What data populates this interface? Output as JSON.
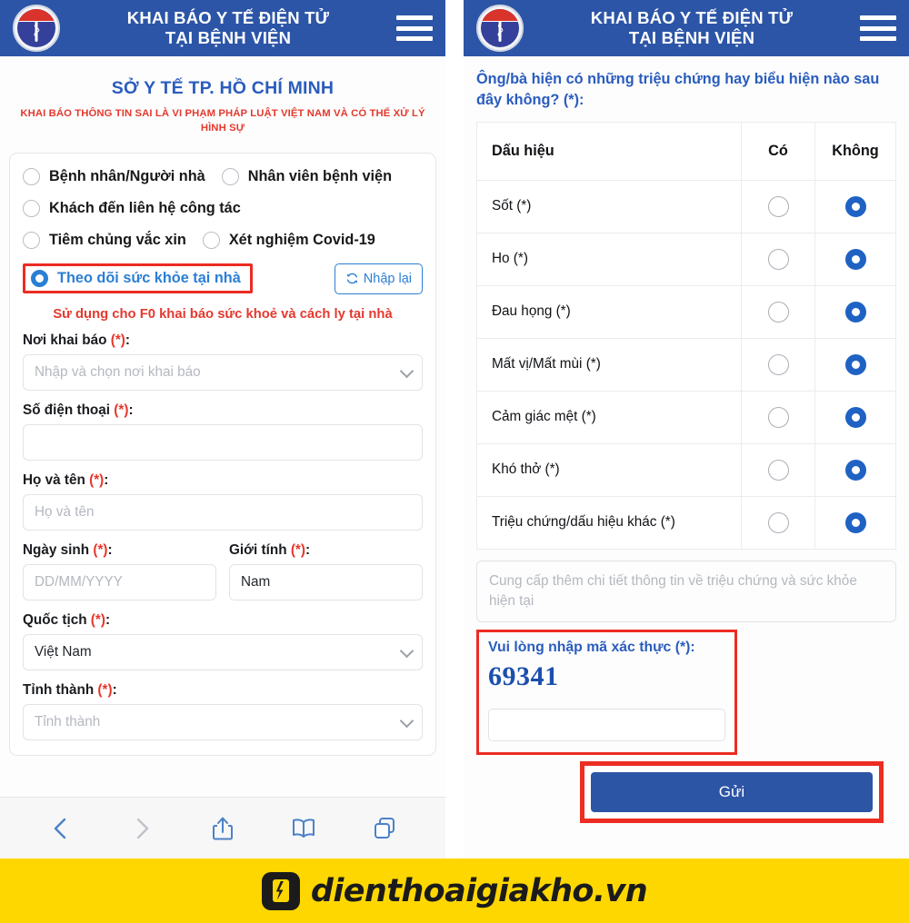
{
  "header": {
    "title_line1": "KHAI BÁO Y TẾ ĐIỆN TỬ",
    "title_line2": "TẠI BỆNH VIỆN",
    "logo_name": "ministry-of-health-emblem",
    "menu_icon": "hamburger-menu-icon",
    "bg_color": "#2c55a7"
  },
  "left": {
    "org_title": "SỞ Y TẾ TP. HỒ CHÍ MINH",
    "warning": "KHAI BÁO THÔNG TIN SAI LÀ VI PHẠM PHÁP LUẬT VIỆT NAM VÀ CÓ THỂ XỬ LÝ HÌNH SỰ",
    "radio_options": [
      {
        "label": "Bệnh nhân/Người nhà",
        "selected": false
      },
      {
        "label": "Nhân viên bệnh viện",
        "selected": false
      },
      {
        "label": "Khách đến liên hệ công tác",
        "selected": false
      },
      {
        "label": "Tiêm chủng vắc xin",
        "selected": false
      },
      {
        "label": "Xét nghiệm Covid-19",
        "selected": false
      },
      {
        "label": "Theo dõi sức khỏe tại nhà",
        "selected": true
      }
    ],
    "reset_button": "Nhập lại",
    "reset_icon": "refresh-icon",
    "note": "Sử dụng cho F0 khai báo sức khoẻ và cách ly tại nhà",
    "fields": [
      {
        "label": "Nơi khai báo",
        "required": "(*)",
        "placeholder": "Nhập và chọn nơi khai báo",
        "value": "",
        "type": "select"
      },
      {
        "label": "Số điện thoại",
        "required": "(*)",
        "placeholder": "",
        "value": "",
        "type": "text"
      },
      {
        "label": "Họ và tên",
        "required": "(*)",
        "placeholder": "Họ và tên",
        "value": "",
        "type": "text"
      },
      {
        "label": "Ngày sinh",
        "required": "(*)",
        "placeholder": "DD/MM/YYYY",
        "value": "",
        "type": "text"
      },
      {
        "label": "Giới tính",
        "required": "(*)",
        "placeholder": "",
        "value": "Nam",
        "type": "text"
      },
      {
        "label": "Quốc tịch",
        "required": "(*)",
        "placeholder": "",
        "value": "Việt Nam",
        "type": "select"
      },
      {
        "label": "Tỉnh thành",
        "required": "(*)",
        "placeholder": "Tỉnh thành",
        "value": "",
        "type": "select"
      }
    ],
    "toolbar": [
      {
        "name": "back-icon",
        "enabled": true
      },
      {
        "name": "forward-icon",
        "enabled": false
      },
      {
        "name": "share-icon",
        "enabled": true
      },
      {
        "name": "bookmarks-icon",
        "enabled": true
      },
      {
        "name": "tabs-icon",
        "enabled": true
      }
    ]
  },
  "right": {
    "question": "Ông/bà hiện có những triệu chứng hay biểu hiện nào sau đây không? (*):",
    "table": {
      "columns": [
        "Dấu hiệu",
        "Có",
        "Không"
      ],
      "rows": [
        {
          "name": "Sốt (*)",
          "yes": false,
          "no": true
        },
        {
          "name": "Ho (*)",
          "yes": false,
          "no": true
        },
        {
          "name": "Đau họng (*)",
          "yes": false,
          "no": true
        },
        {
          "name": "Mất vị/Mất mùi (*)",
          "yes": false,
          "no": true
        },
        {
          "name": "Cảm giác mệt (*)",
          "yes": false,
          "no": true
        },
        {
          "name": "Khó thở (*)",
          "yes": false,
          "no": true
        },
        {
          "name": "Triệu chứng/dấu hiệu khác (*)",
          "yes": false,
          "no": true
        }
      ]
    },
    "details_placeholder": "Cung cấp thêm chi tiết thông tin về triệu chứng và sức khỏe hiện tại",
    "captcha_label": "Vui lòng nhập mã xác thực (*):",
    "captcha_code": "69341",
    "captcha_value": "",
    "submit_label": "Gửi"
  },
  "footer": {
    "brand": "dienthoaigiakho",
    "tld": ".vn",
    "logo_name": "dienthoaigiakho-logo",
    "bg_color": "#ffd700"
  }
}
